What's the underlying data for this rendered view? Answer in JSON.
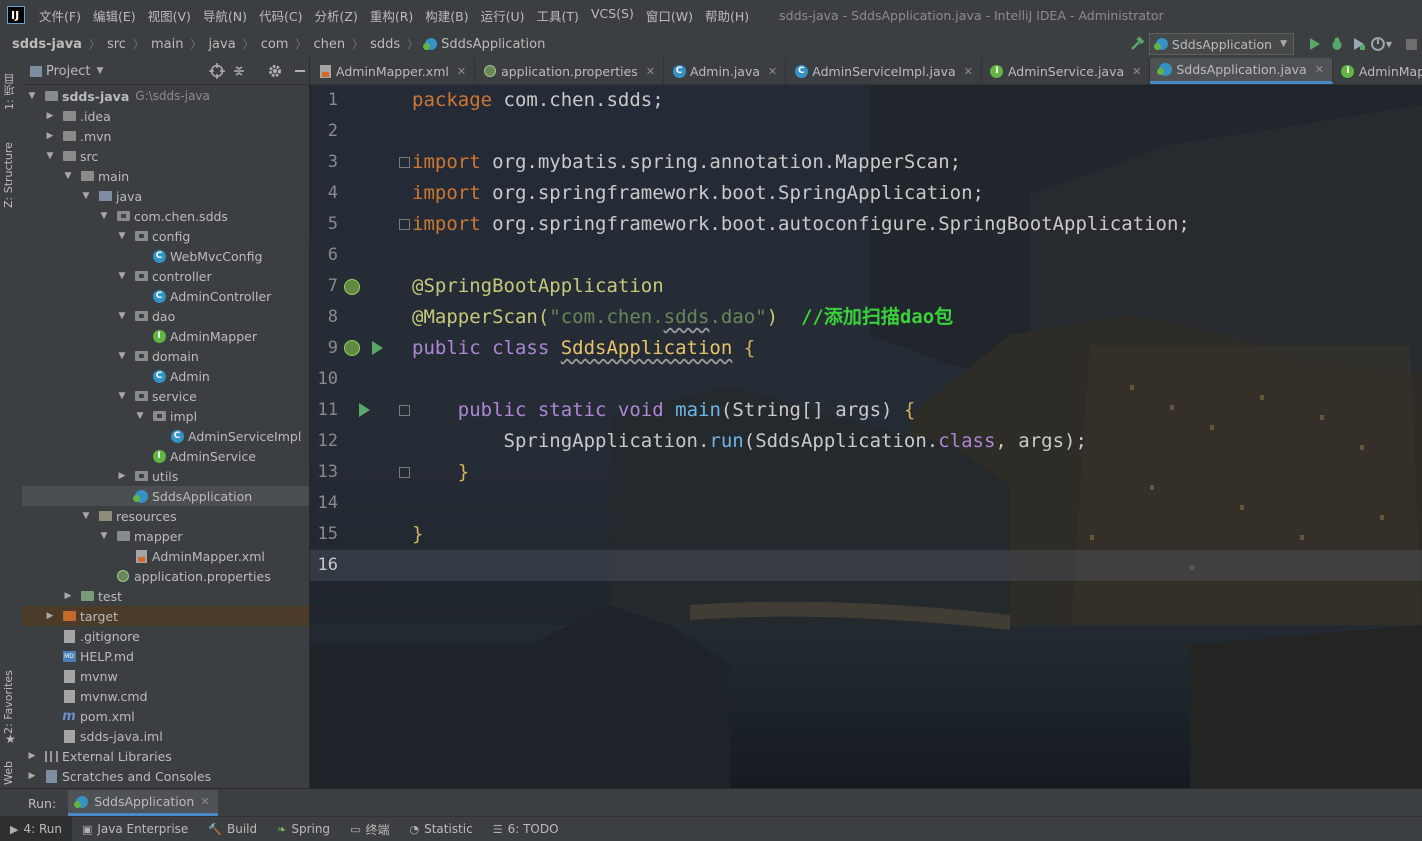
{
  "menu": {
    "items": [
      "文件(F)",
      "编辑(E)",
      "视图(V)",
      "导航(N)",
      "代码(C)",
      "分析(Z)",
      "重构(R)",
      "构建(B)",
      "运行(U)",
      "工具(T)",
      "VCS(S)",
      "窗口(W)",
      "帮助(H)"
    ],
    "window_title": "sdds-java - SddsApplication.java - IntelliJ IDEA - Administrator"
  },
  "nav": {
    "crumbs": [
      "sdds-java",
      "src",
      "main",
      "java",
      "com",
      "chen",
      "sdds",
      "SddsApplication"
    ],
    "run_config": "SddsApplication"
  },
  "left_stripe": {
    "project_tab": "1: 项目",
    "structure_tab": "Z: Structure",
    "favorites_tab": "2: Favorites",
    "web_tab": "Web"
  },
  "project": {
    "title": "Project",
    "tree": [
      {
        "label": "sdds-java",
        "path": "G:\\sdds-java",
        "depth": 0,
        "open": true,
        "icon": "folder-icon",
        "bold": true
      },
      {
        "label": ".idea",
        "depth": 1,
        "open": false,
        "icon": "folder-icon"
      },
      {
        "label": ".mvn",
        "depth": 1,
        "open": false,
        "icon": "folder-icon"
      },
      {
        "label": "src",
        "depth": 1,
        "open": true,
        "icon": "folder-icon"
      },
      {
        "label": "main",
        "depth": 2,
        "open": true,
        "icon": "folder-icon"
      },
      {
        "label": "java",
        "depth": 3,
        "open": true,
        "icon": "source-folder-icon"
      },
      {
        "label": "com.chen.sdds",
        "depth": 4,
        "open": true,
        "icon": "package-icon"
      },
      {
        "label": "config",
        "depth": 5,
        "open": true,
        "icon": "package-icon"
      },
      {
        "label": "WebMvcConfig",
        "depth": 6,
        "icon": "class-icon"
      },
      {
        "label": "controller",
        "depth": 5,
        "open": true,
        "icon": "package-icon"
      },
      {
        "label": "AdminController",
        "depth": 6,
        "icon": "class-icon"
      },
      {
        "label": "dao",
        "depth": 5,
        "open": true,
        "icon": "package-icon"
      },
      {
        "label": "AdminMapper",
        "depth": 6,
        "icon": "interface-icon"
      },
      {
        "label": "domain",
        "depth": 5,
        "open": true,
        "icon": "package-icon"
      },
      {
        "label": "Admin",
        "depth": 6,
        "icon": "class-icon"
      },
      {
        "label": "service",
        "depth": 5,
        "open": true,
        "icon": "package-icon"
      },
      {
        "label": "impl",
        "depth": 6,
        "open": true,
        "icon": "package-icon"
      },
      {
        "label": "AdminServiceImpl",
        "depth": 7,
        "icon": "class-icon"
      },
      {
        "label": "AdminService",
        "depth": 6,
        "icon": "interface-icon"
      },
      {
        "label": "utils",
        "depth": 5,
        "open": false,
        "icon": "package-icon"
      },
      {
        "label": "SddsApplication",
        "depth": 5,
        "icon": "spring-boot-class-icon",
        "selected": true
      },
      {
        "label": "resources",
        "depth": 3,
        "open": true,
        "icon": "resources-folder-icon"
      },
      {
        "label": "mapper",
        "depth": 4,
        "open": true,
        "icon": "folder-icon"
      },
      {
        "label": "AdminMapper.xml",
        "depth": 5,
        "icon": "xml-file-icon"
      },
      {
        "label": "application.properties",
        "depth": 4,
        "icon": "properties-file-icon"
      },
      {
        "label": "test",
        "depth": 2,
        "open": false,
        "icon": "test-folder-icon"
      },
      {
        "label": "target",
        "depth": 1,
        "open": false,
        "icon": "excluded-folder-icon",
        "excluded": true
      },
      {
        "label": ".gitignore",
        "depth": 1,
        "icon": "text-file-icon"
      },
      {
        "label": "HELP.md",
        "depth": 1,
        "icon": "markdown-file-icon"
      },
      {
        "label": "mvnw",
        "depth": 1,
        "icon": "text-file-icon"
      },
      {
        "label": "mvnw.cmd",
        "depth": 1,
        "icon": "text-file-icon"
      },
      {
        "label": "pom.xml",
        "depth": 1,
        "icon": "maven-icon"
      },
      {
        "label": "sdds-java.iml",
        "depth": 1,
        "icon": "text-file-icon"
      },
      {
        "label": "External Libraries",
        "depth": 0,
        "open": false,
        "icon": "library-icon"
      },
      {
        "label": "Scratches and Consoles",
        "depth": 0,
        "open": false,
        "icon": "scratches-icon"
      }
    ]
  },
  "tabs": [
    {
      "label": "AdminMapper.xml",
      "icon": "xml-file-icon"
    },
    {
      "label": "application.properties",
      "icon": "properties-file-icon"
    },
    {
      "label": "Admin.java",
      "icon": "class-icon"
    },
    {
      "label": "AdminServiceImpl.java",
      "icon": "class-icon"
    },
    {
      "label": "AdminService.java",
      "icon": "interface-icon"
    },
    {
      "label": "SddsApplication.java",
      "icon": "spring-boot-class-icon",
      "active": true
    },
    {
      "label": "AdminMapper.java",
      "icon": "interface-icon"
    }
  ],
  "editor": {
    "line_numbers": [
      "1",
      "2",
      "3",
      "4",
      "5",
      "6",
      "7",
      "8",
      "9",
      "10",
      "11",
      "12",
      "13",
      "14",
      "15",
      "16"
    ],
    "current_line": 16,
    "lines": [
      [
        {
          "t": "package ",
          "c": "kw"
        },
        {
          "t": "com.chen.sdds;",
          "c": "plain"
        }
      ],
      [],
      [
        {
          "t": "import ",
          "c": "kw"
        },
        {
          "t": "org.mybatis.spring.annotation.MapperScan;",
          "c": "plain"
        }
      ],
      [
        {
          "t": "import ",
          "c": "kw"
        },
        {
          "t": "org.springframework.boot.SpringApplication;",
          "c": "plain"
        }
      ],
      [
        {
          "t": "import ",
          "c": "kw"
        },
        {
          "t": "org.springframework.boot.autoconfigure.SpringBootApplication;",
          "c": "plain"
        }
      ],
      [],
      [
        {
          "t": "@SpringBootApplication",
          "c": "ann"
        }
      ],
      [
        {
          "t": "@MapperScan(",
          "c": "ann"
        },
        {
          "t": "\"com.chen.",
          "c": "str"
        },
        {
          "t": "sdds",
          "c": "str squiggle"
        },
        {
          "t": ".dao\"",
          "c": "str"
        },
        {
          "t": ")",
          "c": "ann"
        },
        {
          "t": "  //添加扫描dao包",
          "c": "cmt"
        }
      ],
      [
        {
          "t": "public ",
          "c": "kw2"
        },
        {
          "t": "class ",
          "c": "kw2"
        },
        {
          "t": "SddsApplication",
          "c": "cls-n squiggle"
        },
        {
          "t": " {",
          "c": "br"
        }
      ],
      [],
      [
        {
          "t": "    public ",
          "c": "kw2"
        },
        {
          "t": "static ",
          "c": "kw2"
        },
        {
          "t": "void ",
          "c": "kw2"
        },
        {
          "t": "main",
          "c": "fn"
        },
        {
          "t": "(String[] args) ",
          "c": "plain"
        },
        {
          "t": "{",
          "c": "br"
        }
      ],
      [
        {
          "t": "        SpringApplication.",
          "c": "plain"
        },
        {
          "t": "run",
          "c": "fn"
        },
        {
          "t": "(SddsApplication.",
          "c": "plain"
        },
        {
          "t": "class",
          "c": "kw2"
        },
        {
          "t": ", args);",
          "c": "plain"
        }
      ],
      [
        {
          "t": "    }",
          "c": "br"
        }
      ],
      [],
      [
        {
          "t": "}",
          "c": "br"
        }
      ],
      []
    ]
  },
  "run": {
    "label": "Run:",
    "tab": "SddsApplication"
  },
  "bottom": {
    "items": [
      {
        "label": "4: Run",
        "icon": "run-icon",
        "active": true
      },
      {
        "label": "Java Enterprise",
        "icon": "java-enterprise-icon"
      },
      {
        "label": "Build",
        "icon": "build-icon"
      },
      {
        "label": "Spring",
        "icon": "spring-icon"
      },
      {
        "label": "终端",
        "icon": "terminal-icon"
      },
      {
        "label": "Statistic",
        "icon": "statistic-icon"
      },
      {
        "label": "6: TODO",
        "icon": "todo-icon"
      }
    ]
  }
}
